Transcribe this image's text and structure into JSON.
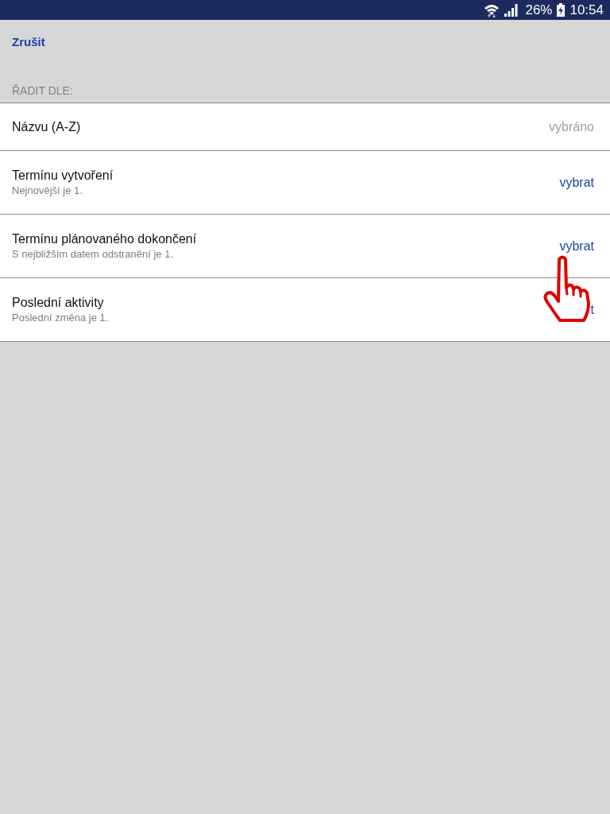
{
  "status_bar": {
    "battery": "26%",
    "time": "10:54"
  },
  "header": {
    "cancel": "Zrušit",
    "section_label": "ŘADIT DLE:"
  },
  "sort_options": [
    {
      "title": "Názvu (A-Z)",
      "action": "vybráno",
      "selected": true
    },
    {
      "title": "Termínu vytvoření",
      "subtitle": "Nejnovější je 1.",
      "action": "vybrat",
      "selected": false
    },
    {
      "title": "Termínu plánovaného dokončení",
      "subtitle": "S nejbližším datem odstranění je 1.",
      "action": "vybrat",
      "selected": false
    },
    {
      "title": "Poslední aktivity",
      "subtitle": "Poslední změna je 1.",
      "action": "t",
      "selected": false
    }
  ]
}
